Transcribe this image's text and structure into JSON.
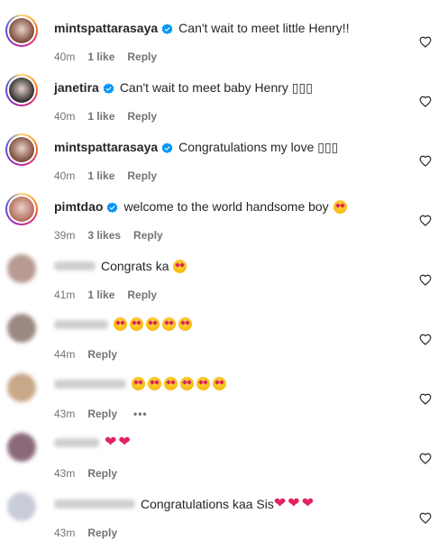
{
  "comments": [
    {
      "username": "mintspattarasaya",
      "verified": true,
      "avatar_color": "#7a4a3a",
      "ring": true,
      "text": "Can't wait to meet little Henry!!",
      "time": "40m",
      "likes": "1 like",
      "reply": "Reply"
    },
    {
      "username": "janetira",
      "verified": true,
      "avatar_color": "#2b2b2b",
      "ring": true,
      "text": "Can't wait to meet baby Henry ▯▯▯",
      "time": "40m",
      "likes": "1 like",
      "reply": "Reply"
    },
    {
      "username": "mintspattarasaya",
      "verified": true,
      "avatar_color": "#7a4a3a",
      "ring": true,
      "text": "Congratulations my love ▯▯▯",
      "time": "40m",
      "likes": "1 like",
      "reply": "Reply"
    },
    {
      "username": "pimtdao",
      "verified": true,
      "avatar_color": "#b56b5c",
      "ring": true,
      "text": "welcome to the world handsome boy",
      "emoji_count": 1,
      "time": "39m",
      "likes": "3 likes",
      "reply": "Reply"
    },
    {
      "username": "",
      "blurred_name_width": 46,
      "avatar_color": "#b89a92",
      "text": "Congrats ka",
      "emoji_count": 1,
      "time": "41m",
      "likes": "1 like",
      "reply": "Reply"
    },
    {
      "username": "",
      "blurred_name_width": 60,
      "avatar_color": "#9b8880",
      "text": "",
      "emoji_count": 5,
      "time": "44m",
      "likes": "",
      "reply": "Reply"
    },
    {
      "username": "",
      "blurred_name_width": 80,
      "avatar_color": "#c9a88a",
      "text": "",
      "emoji_count": 6,
      "time": "43m",
      "likes": "",
      "reply": "Reply",
      "more": "•••"
    },
    {
      "username": "",
      "blurred_name_width": 50,
      "avatar_color": "#8a6a7a",
      "text": "",
      "hearts": 2,
      "time": "43m",
      "likes": "",
      "reply": "Reply"
    },
    {
      "username": "",
      "blurred_name_width": 90,
      "avatar_color": "#c8ccd8",
      "text": "Congratulations kaa Sis",
      "hearts": 3,
      "time": "43m",
      "likes": "",
      "reply": "Reply"
    }
  ],
  "icons": {
    "like": "heart-outline-icon",
    "verified": "verified-badge-icon"
  },
  "colors": {
    "verified": "#0095f6",
    "meta": "#737373",
    "heart": "#e0245e"
  }
}
